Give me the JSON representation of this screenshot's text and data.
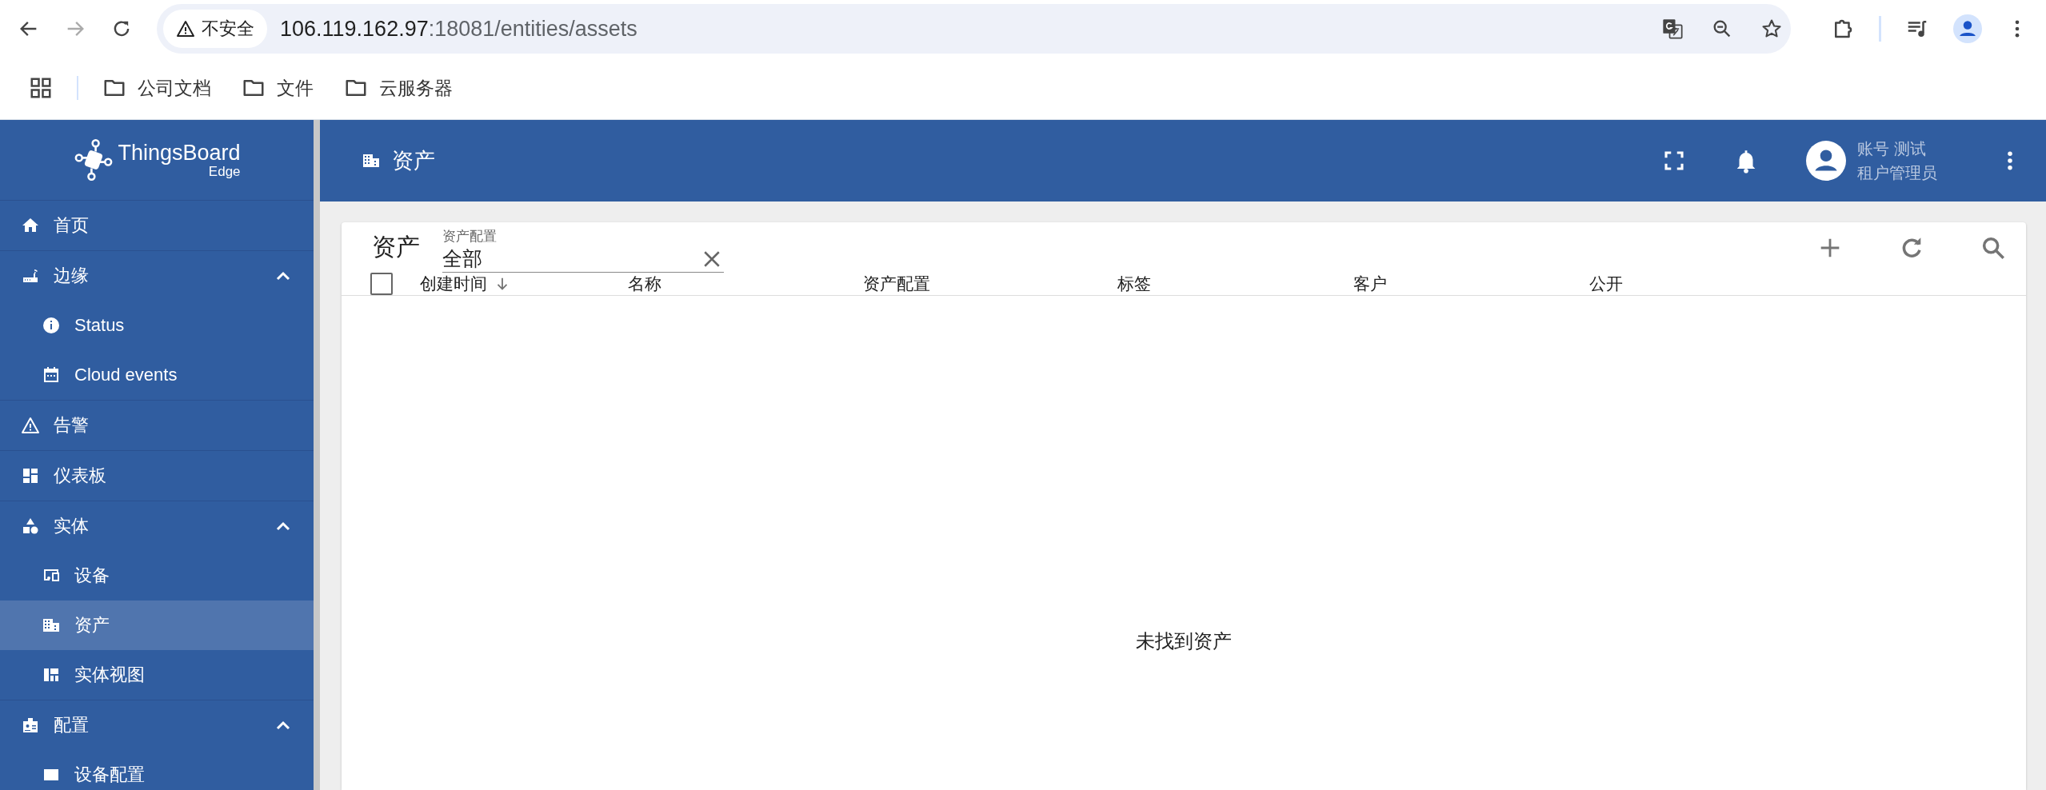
{
  "browser": {
    "forward_disabled": true,
    "security_label": "不安全",
    "url_host": "106.119.162.97",
    "url_rest": ":18081/entities/assets",
    "bookmarks": [
      "公司文档",
      "文件",
      "云服务器"
    ]
  },
  "logo": {
    "name": "ThingsBoard",
    "edition": "Edge"
  },
  "sidebar": {
    "items": [
      {
        "label": "首页",
        "kind": "home",
        "selected": false
      },
      {
        "label": "边缘",
        "kind": "router",
        "expanded": true,
        "children": [
          {
            "label": "Status",
            "kind": "info",
            "selected": false
          },
          {
            "label": "Cloud events",
            "kind": "calendar",
            "selected": false
          }
        ]
      },
      {
        "label": "告警",
        "kind": "warning",
        "selected": false
      },
      {
        "label": "仪表板",
        "kind": "dashboard",
        "selected": false
      },
      {
        "label": "实体",
        "kind": "shapes",
        "expanded": true,
        "children": [
          {
            "label": "设备",
            "kind": "devices",
            "selected": false
          },
          {
            "label": "资产",
            "kind": "building",
            "selected": true
          },
          {
            "label": "实体视图",
            "kind": "view",
            "selected": false
          }
        ]
      },
      {
        "label": "配置",
        "kind": "badge",
        "expanded": true,
        "children": [
          {
            "label": "设备配置",
            "kind": "profile",
            "selected": false
          }
        ]
      }
    ]
  },
  "topbar": {
    "title": "资产",
    "user_name": "账号 测试",
    "user_role": "租户管理员"
  },
  "card": {
    "title": "资产",
    "filter": {
      "label": "资产配置",
      "value": "全部"
    },
    "header_checkbox": {
      "checked": false
    },
    "columns": [
      {
        "label": "创建时间",
        "sorted": true
      },
      {
        "label": "名称",
        "sorted": false
      },
      {
        "label": "资产配置",
        "sorted": false
      },
      {
        "label": "标签",
        "sorted": false
      },
      {
        "label": "客户",
        "sorted": false
      },
      {
        "label": "公开",
        "sorted": false
      }
    ],
    "empty_message": "未找到资产"
  }
}
